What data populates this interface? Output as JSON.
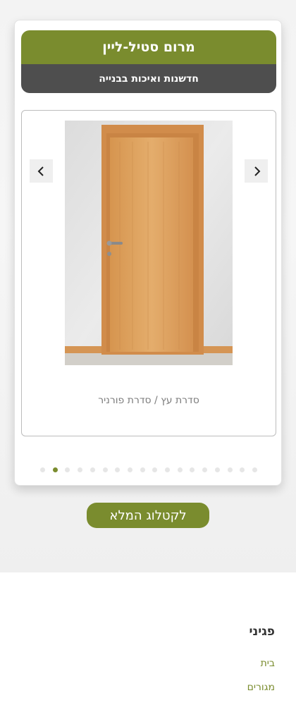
{
  "header": {
    "title": "מרום סטיל-ליין",
    "subtitle": "חדשנות ואיכות בבנייה"
  },
  "carousel": {
    "caption": "סדרת עץ / סדרת פורניר",
    "image_icon": "wooden-door-image",
    "prev_icon": "chevron-left-icon",
    "next_icon": "chevron-right-icon",
    "dot_count": 18,
    "active_dot": 1
  },
  "catalog_button": {
    "label": "לקטלוג המלא"
  },
  "footer": {
    "title": "פגיני",
    "links": [
      {
        "label": "בית"
      },
      {
        "label": "מגורים"
      }
    ]
  },
  "colors": {
    "accent": "#7a8c2e",
    "header_dark": "#4e4e4e",
    "caption": "#7c7c7c",
    "dot_inactive": "#e6e6e6"
  }
}
